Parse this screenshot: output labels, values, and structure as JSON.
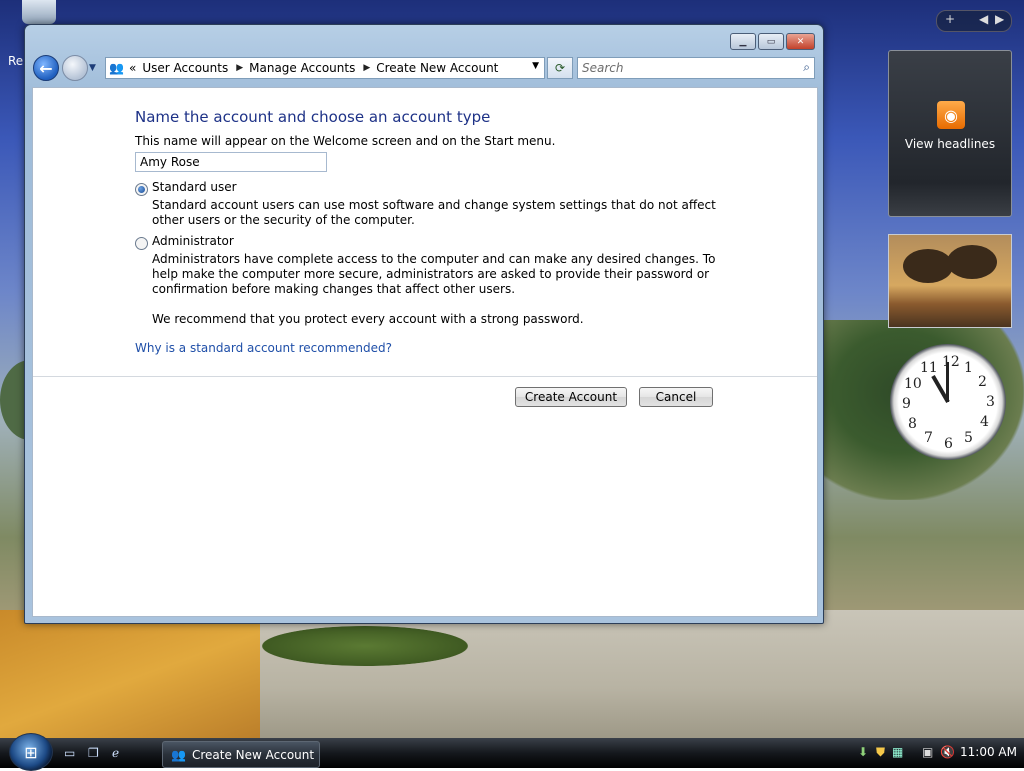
{
  "desktop": {
    "recycle_label": "Re"
  },
  "window": {
    "breadcrumb": [
      "User Accounts",
      "Manage Accounts",
      "Create New Account"
    ],
    "breadcrumb_prefix": "«",
    "search_placeholder": "Search",
    "heading": "Name the account and choose an account type",
    "description": "This name will appear on the Welcome screen and on the Start menu.",
    "name_value": "Amy Rose",
    "standard": {
      "label": "Standard user",
      "text": "Standard account users can use most software and change system settings that do not affect other users or the security of the computer.",
      "selected": true
    },
    "admin": {
      "label": "Administrator",
      "text": "Administrators have complete access to the computer and can make any desired changes. To help make the computer more secure, administrators are asked to provide their password or confirmation before making changes that affect other users.",
      "selected": false
    },
    "recommend": "We recommend that you protect every account with a strong password.",
    "link": "Why is a standard account recommended?",
    "create_button": "Create Account",
    "cancel_button": "Cancel"
  },
  "gadgets": {
    "rss_label": "View headlines",
    "clock": {
      "time": "11:00",
      "numbers": [
        "12",
        "1",
        "2",
        "3",
        "4",
        "5",
        "6",
        "7",
        "8",
        "9",
        "10",
        "11"
      ]
    }
  },
  "taskbar": {
    "task_label": "Create New Account",
    "time": "11:00 AM"
  },
  "colors": {
    "heading": "#1e3287",
    "link": "#1f4fa8"
  },
  "icons": [
    "back-icon",
    "forward-icon",
    "user-accounts-icon",
    "refresh-icon",
    "search-icon",
    "rss-icon",
    "start-orb-icon",
    "show-desktop-icon",
    "switch-windows-icon",
    "ie-icon",
    "network-icon",
    "volume-muted-icon",
    "security-shield-icon"
  ]
}
